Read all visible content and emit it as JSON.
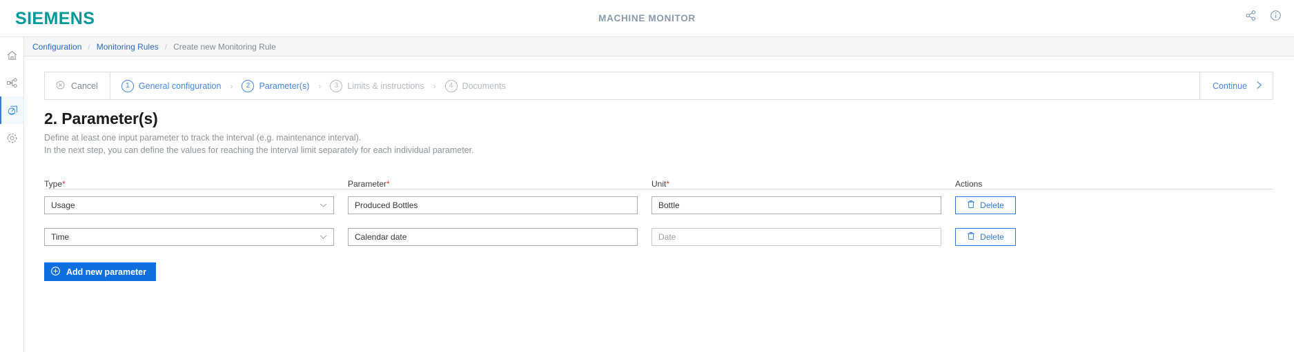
{
  "header": {
    "brand": "SIEMENS",
    "app_title": "MACHINE MONITOR",
    "icons": [
      {
        "name": "share-nodes-icon"
      },
      {
        "name": "info-circle-icon"
      }
    ]
  },
  "sidebar": {
    "items": [
      {
        "name": "home-icon",
        "active": false
      },
      {
        "name": "hierarchy-icon",
        "active": false
      },
      {
        "name": "monitoring-rules-icon",
        "active": true
      },
      {
        "name": "gear-icon",
        "active": false
      }
    ]
  },
  "breadcrumb": {
    "items": [
      {
        "label": "Configuration",
        "link": true
      },
      {
        "label": "Monitoring Rules",
        "link": true
      },
      {
        "label": "Create new Monitoring Rule",
        "link": false
      }
    ],
    "separator": "/"
  },
  "wizard": {
    "cancel_label": "Cancel",
    "continue_label": "Continue",
    "chevron": "›",
    "steps": [
      {
        "num": "1",
        "label": "General configuration",
        "state": "done"
      },
      {
        "num": "2",
        "label": "Parameter(s)",
        "state": "current"
      },
      {
        "num": "3",
        "label": "Limits & instructions",
        "state": "todo"
      },
      {
        "num": "4",
        "label": "Documents",
        "state": "todo"
      }
    ]
  },
  "page": {
    "title": "2. Parameter(s)",
    "subline_1": "Define at least one input parameter to track the interval (e.g. maintenance interval).",
    "subline_2": "In the next step, you can define the values for reaching the interval limit separately for each individual parameter."
  },
  "table": {
    "headers": {
      "type": "Type",
      "parameter": "Parameter",
      "unit": "Unit",
      "actions": "Actions",
      "required_mark": "*"
    },
    "rows": [
      {
        "type": "Usage",
        "parameter": "Produced Bottles",
        "unit": "Bottle",
        "unit_muted": false,
        "delete_label": "Delete"
      },
      {
        "type": "Time",
        "parameter": "Calendar date",
        "unit": "Date",
        "unit_muted": true,
        "delete_label": "Delete"
      }
    ]
  },
  "actions": {
    "add_label": "Add new parameter"
  },
  "colors": {
    "brand": "#009999",
    "link": "#2c6bbd",
    "accent": "#0f6fe0",
    "required": "#d93a3a",
    "muted": "#8c959c"
  }
}
